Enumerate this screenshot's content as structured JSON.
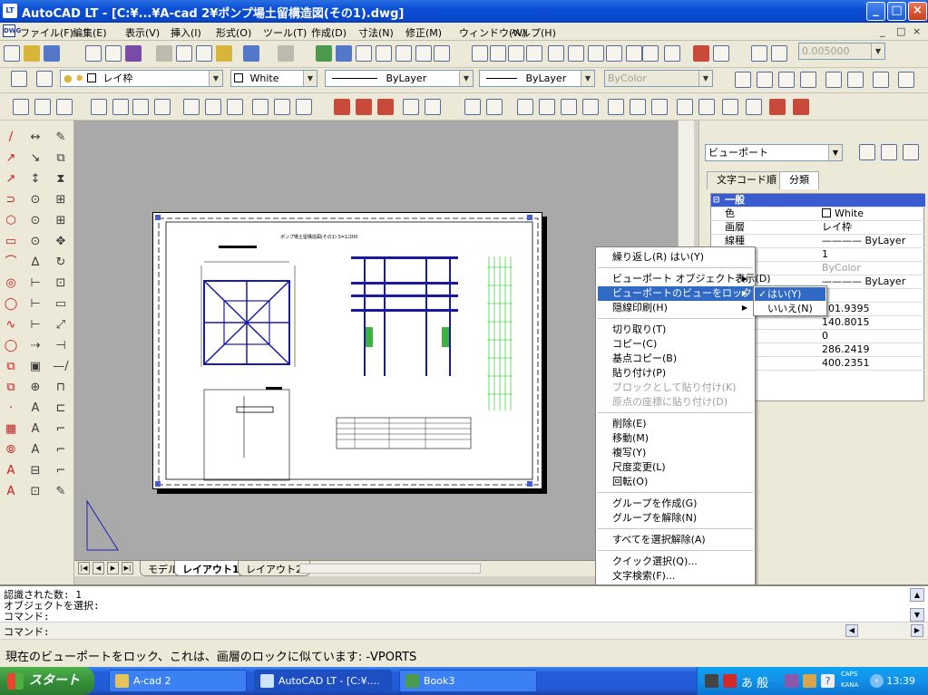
{
  "window": {
    "title": "AutoCAD LT - [C:¥...¥A-cad 2¥ポンプ場土留構造図(その1).dwg]",
    "app_icon_label": "LT",
    "minimize": "_",
    "maximize": "□",
    "close": "×"
  },
  "menubar": {
    "items": [
      "ファイル(F)",
      "編集(E)",
      "表示(V)",
      "挿入(I)",
      "形式(O)",
      "ツール(T)",
      "作成(D)",
      "寸法(N)",
      "修正(M)",
      "ウィンドウ(W)",
      "ヘルプ(H)"
    ],
    "doc_controls": [
      "_",
      "□",
      "×"
    ]
  },
  "toolbar1": {
    "zoom_value": "0.005000",
    "icons": [
      "new-icon",
      "open-icon",
      "save-icon",
      "print-icon",
      "preview-icon",
      "find-icon",
      "cut-icon",
      "copy-icon",
      "paste-icon",
      "match-icon",
      "undo-icon",
      "redo-icon",
      "pan-icon",
      "zoom-icon",
      "help-icon"
    ]
  },
  "toolbar2": {
    "layer": "レイ枠",
    "color": "White",
    "linetype": "ByLayer",
    "lineweight": "ByLayer",
    "plotstyle": "ByColor"
  },
  "drawing": {
    "paper_title": "ポンプ場土留構造図(その1) S=1/200",
    "layout_tabs": [
      "モデル",
      "レイアウト1",
      "レイアウト2"
    ],
    "active_tab": "レイアウト1",
    "nav_buttons": [
      "|◀",
      "◀",
      "▶",
      "▶|"
    ]
  },
  "properties": {
    "selection": "ビューポート",
    "tabs": [
      "文字コード順",
      "分類"
    ],
    "active_tab": "分類",
    "rows": [
      {
        "k": "一般",
        "v": "",
        "head": true
      },
      {
        "k": "色",
        "v": "White"
      },
      {
        "k": "画層",
        "v": "レイ枠"
      },
      {
        "k": "線種",
        "v": "———— ByLayer"
      },
      {
        "k": "度",
        "v": "1"
      },
      {
        "k": "イル",
        "v": "ByColor",
        "dim": true
      },
      {
        "k": "太",
        "v": "———— ByLayer"
      },
      {
        "k": "",
        "v": ""
      },
      {
        "k": "",
        "v": "201.9395"
      },
      {
        "k": "",
        "v": "140.8015"
      },
      {
        "k": "",
        "v": "0"
      },
      {
        "k": "",
        "v": "286.2419"
      },
      {
        "k": "",
        "v": "400.2351"
      }
    ]
  },
  "context_menu": {
    "items": [
      {
        "label": "繰り返し(R) はい(Y)"
      },
      {
        "sep": true
      },
      {
        "label": "ビューポート オブジェクト表示(D)",
        "sub": true
      },
      {
        "label": "ビューポートのビューをロック(L)",
        "sub": true,
        "hl": true
      },
      {
        "label": "隠線印刷(H)",
        "sub": true
      },
      {
        "sep": true
      },
      {
        "label": "切り取り(T)"
      },
      {
        "label": "コピー(C)"
      },
      {
        "label": "基点コピー(B)"
      },
      {
        "label": "貼り付け(P)"
      },
      {
        "label": "ブロックとして貼り付け(K)",
        "dis": true
      },
      {
        "label": "原点の座標に貼り付け(D)",
        "dis": true
      },
      {
        "sep": true
      },
      {
        "label": "削除(E)"
      },
      {
        "label": "移動(M)"
      },
      {
        "label": "複写(Y)"
      },
      {
        "label": "尺度変更(L)"
      },
      {
        "label": "回転(O)"
      },
      {
        "sep": true
      },
      {
        "label": "グループを作成(G)"
      },
      {
        "label": "グループを解除(N)"
      },
      {
        "sep": true
      },
      {
        "label": "すべてを選択解除(A)"
      },
      {
        "sep": true
      },
      {
        "label": "クイック選択(Q)..."
      },
      {
        "label": "文字検索(F)..."
      },
      {
        "label": "オブジェクト プロパティ管理(S)"
      }
    ],
    "submenu": [
      {
        "label": "はい(Y)",
        "checked": true,
        "hl": true
      },
      {
        "label": "いいえ(N)"
      }
    ]
  },
  "command": {
    "lines": [
      "認識された数: 1",
      "オブジェクトを選択:",
      "コマンド:",
      "コマンド:"
    ]
  },
  "status_text": "現在のビューポートをロック、これは、画層のロックに似ています: -VPORTS",
  "taskbar": {
    "start": "スタート",
    "tasks": [
      {
        "label": "A-cad 2",
        "color": "#e8c25a"
      },
      {
        "label": "AutoCAD LT - [C:¥....",
        "color": "#cde3ff",
        "active": true
      },
      {
        "label": "Book3",
        "color": "#4c9a4c"
      }
    ],
    "clock": "13:39",
    "ime_chars": "あ 般",
    "caps": "CAPS",
    "kana": "KANA"
  }
}
